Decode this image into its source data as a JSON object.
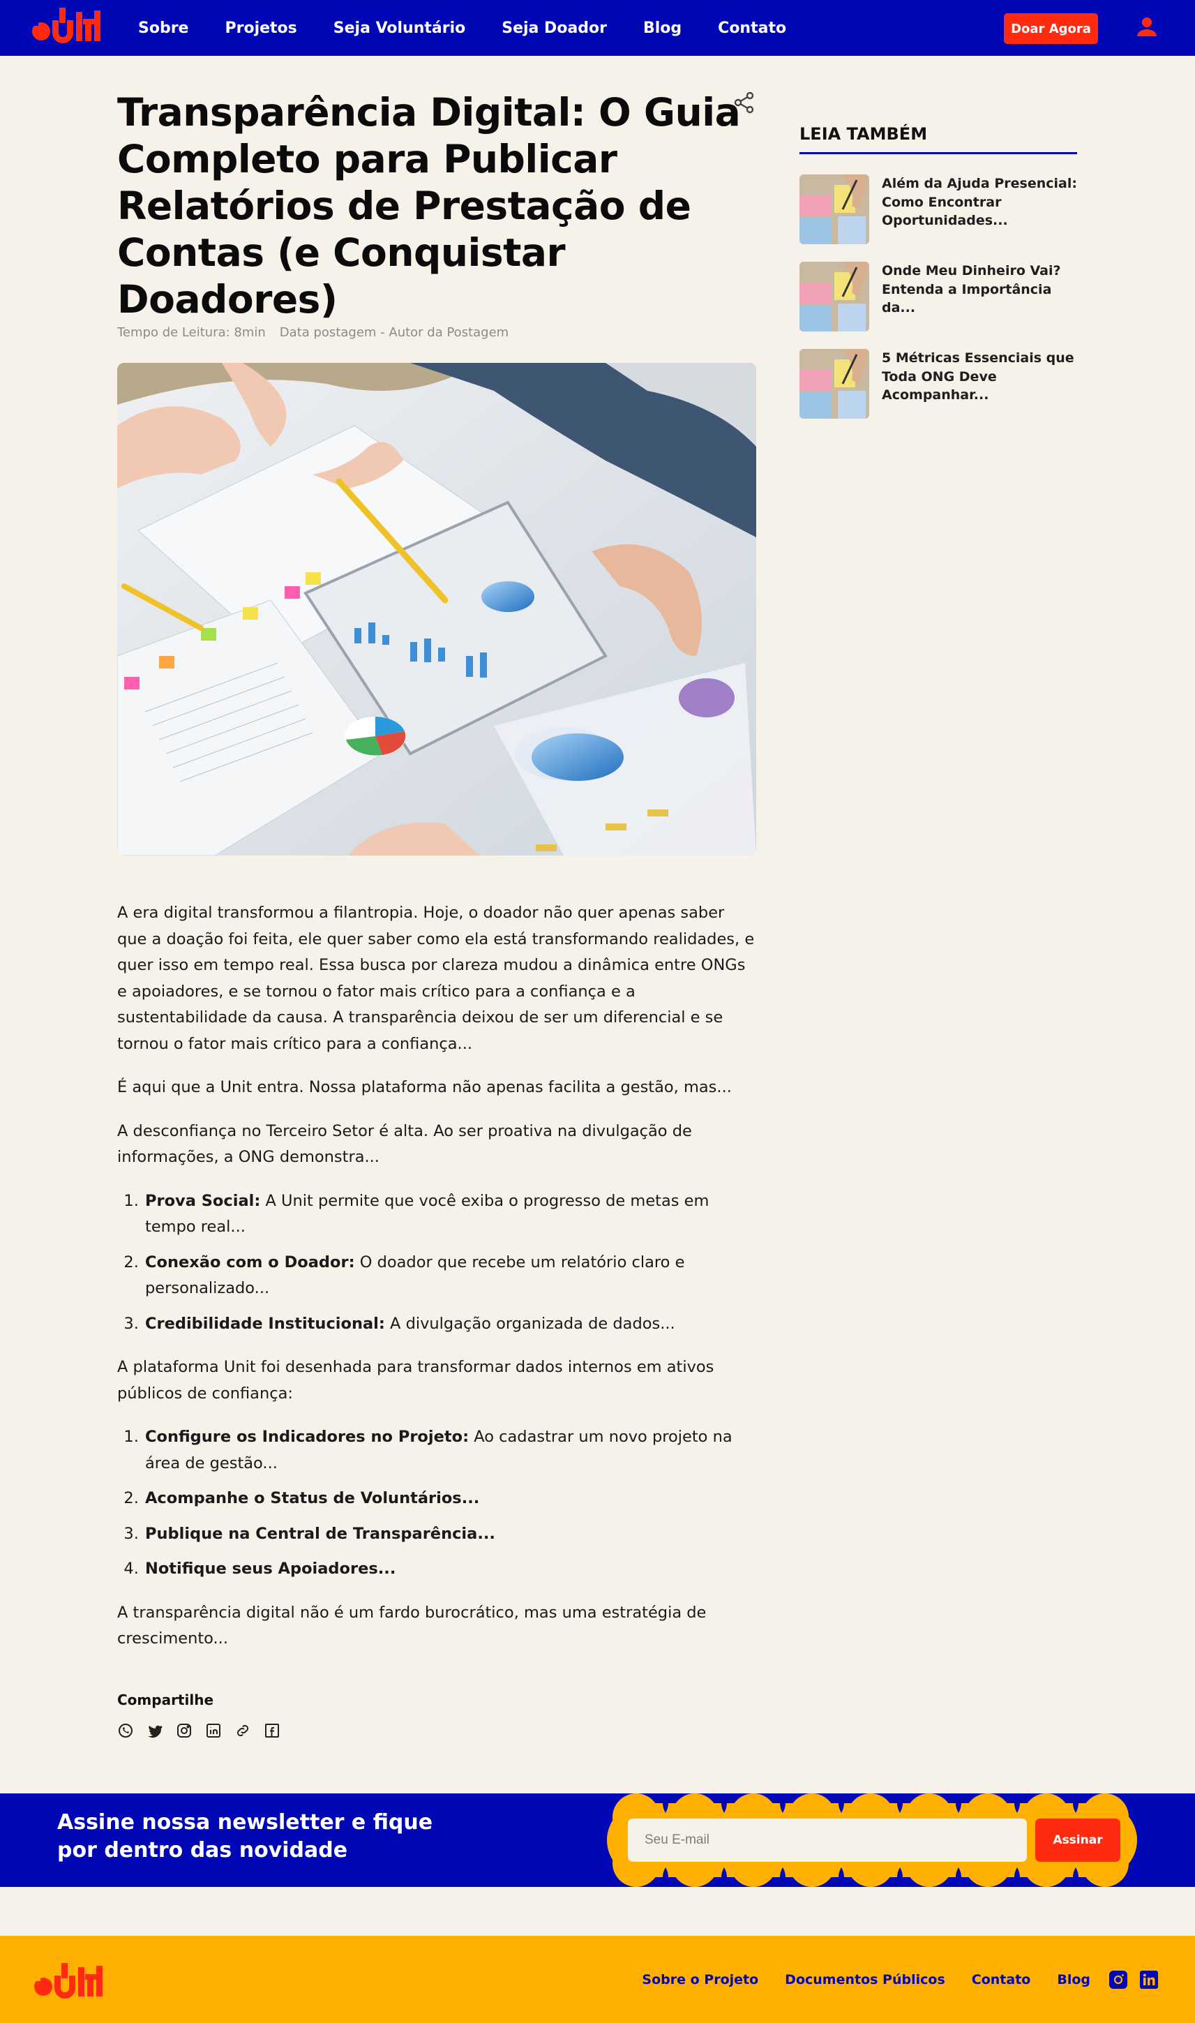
{
  "brand": {
    "name": "Unit",
    "accent": "#0007b4",
    "red": "#ff2a10",
    "yellow": "#ffb000",
    "background": "#f6f2ea"
  },
  "nav": {
    "items": [
      "Sobre",
      "Projetos",
      "Seja Voluntário",
      "Seja Doador",
      "Blog",
      "Contato"
    ],
    "donate_label": "Doar Agora",
    "user_icon": "user-icon"
  },
  "article": {
    "title": "Transparência Digital: O Guia Completo para Publicar Relatórios de Prestação de Contas (e Conquistar Doadores)",
    "reading_time": "Tempo de Leitura: 8min",
    "date_author": "Data postagem - Autor da Postagem",
    "share_icon": "share-icon",
    "p1": "A era digital transformou a filantropia. Hoje, o doador não quer apenas saber que a doação foi feita, ele quer saber como ela está transformando realidades, e quer isso em tempo real. Essa busca por clareza mudou a dinâmica entre ONGs e apoiadores, e se tornou o fator mais crítico para a confiança e a sustentabilidade da causa. A transparência deixou de ser um diferencial e se tornou o fator mais crítico para a confiança...",
    "p2": "É aqui que a Unit entra. Nossa plataforma não apenas facilita a gestão, mas...",
    "p3": "A desconfiança no Terceiro Setor é alta. Ao ser proativa na divulgação de informações, a ONG demonstra...",
    "list1": [
      {
        "bold": "Prova Social:",
        "text": " A Unit permite que você exiba o progresso de metas em tempo real..."
      },
      {
        "bold": "Conexão com o Doador:",
        "text": " O doador que recebe um relatório claro e personalizado..."
      },
      {
        "bold": "Credibilidade Institucional:",
        "text": " A divulgação organizada de dados..."
      }
    ],
    "p4": "A plataforma Unit foi desenhada para transformar dados internos em ativos públicos de confiança:",
    "list2": [
      {
        "bold": "Configure os Indicadores no Projeto:",
        "text": " Ao cadastrar um novo projeto na área de gestão..."
      },
      {
        "bold": "Acompanhe o Status de Voluntários...",
        "text": ""
      },
      {
        "bold": "Publique na Central de Transparência...",
        "text": ""
      },
      {
        "bold": "Notifique seus Apoiadores...",
        "text": ""
      }
    ],
    "p5": "A transparência digital não é um fardo burocrático, mas uma estratégia de crescimento...",
    "share_label": "Compartilhe",
    "share_icons": [
      "whatsapp-icon",
      "twitter-icon",
      "instagram-icon",
      "linkedin-icon",
      "link-icon",
      "facebook-icon"
    ]
  },
  "sidebar": {
    "heading": "LEIA TAMBÉM",
    "items": [
      {
        "title": "Além da Ajuda Presencial: Como Encontrar Oportunidades..."
      },
      {
        "title": "Onde Meu Dinheiro Vai? Entenda a Importância da..."
      },
      {
        "title": "5 Métricas Essenciais que Toda ONG Deve Acompanhar..."
      }
    ]
  },
  "newsletter": {
    "text": "Assine nossa newsletter e fique por dentro das novidade",
    "placeholder": "Seu E-mail",
    "button": "Assinar"
  },
  "footer": {
    "links": [
      "Sobre o Projeto",
      "Documentos Públicos",
      "Contato",
      "Blog"
    ],
    "social": [
      "instagram-icon",
      "linkedin-icon"
    ]
  }
}
